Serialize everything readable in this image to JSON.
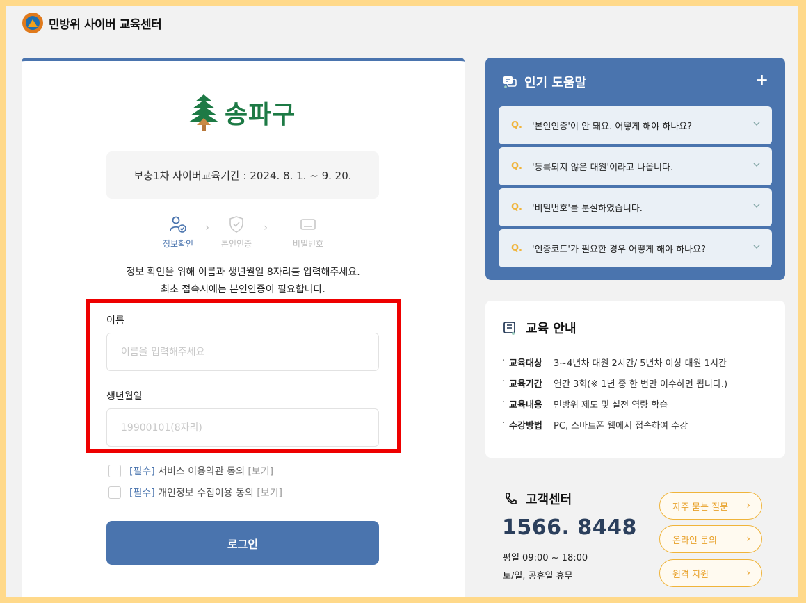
{
  "header": {
    "title": "민방위 사이버 교육센터"
  },
  "login": {
    "brand": "송파구",
    "period": "보충1차 사이버교육기간 : 2024. 8. 1. ~ 9. 20.",
    "steps": [
      {
        "label": "정보확인",
        "icon": "user-check-icon",
        "active": true
      },
      {
        "label": "본인인증",
        "icon": "shield-check-icon",
        "active": false
      },
      {
        "label": "비밀번호",
        "icon": "keyboard-icon",
        "active": false
      }
    ],
    "instructions": [
      "정보 확인을 위해 이름과 생년월일 8자리를 입력해주세요.",
      "최초 접속시에는 본인인증이 필요합니다."
    ],
    "name_label": "이름",
    "name_placeholder": "이름을 입력해주세요",
    "birth_label": "생년월일",
    "birth_placeholder": "19900101(8자리)",
    "agreements": [
      {
        "required": "[필수]",
        "text": "서비스 이용약관 동의",
        "view": "[보기]"
      },
      {
        "required": "[필수]",
        "text": "개인정보 수집이용 동의",
        "view": "[보기]"
      }
    ],
    "login_button": "로그인"
  },
  "faq": {
    "title": "인기 도움말",
    "plus": "+",
    "q_mark": "Q.",
    "items": [
      "'본인인증'이 안 돼요. 어떻게 해야 하나요?",
      "'등록되지 않은 대원'이라고 나옵니다.",
      "'비밀번호'를 분실하였습니다.",
      "'인증코드'가 필요한 경우 어떻게 해야 하나요?"
    ]
  },
  "education": {
    "title": "교육 안내",
    "rows": [
      {
        "key": "교육대상",
        "value": "3~4년차 대원 2시간/ 5년차 이상 대원 1시간"
      },
      {
        "key": "교육기간",
        "value": "연간 3회(※ 1년 중 한 번만 이수하면 됩니다.)"
      },
      {
        "key": "교육내용",
        "value": "민방위 제도 및 실전 역량 학습"
      },
      {
        "key": "수강방법",
        "value": "PC, 스마트폰 웹에서 접속하여 수강"
      }
    ]
  },
  "customer_center": {
    "title": "고객센터",
    "phone": "1566. 8448",
    "hours_weekday": "평일 09:00 ~ 18:00",
    "hours_weekend": "토/일, 공휴일 휴무",
    "buttons": [
      "자주 묻는 질문",
      "온라인 문의",
      "원격 지원"
    ]
  },
  "colors": {
    "primary": "#4a74ae",
    "accent": "#f0b43a",
    "brand_green": "#1d7a45",
    "highlight": "#ee0000"
  }
}
